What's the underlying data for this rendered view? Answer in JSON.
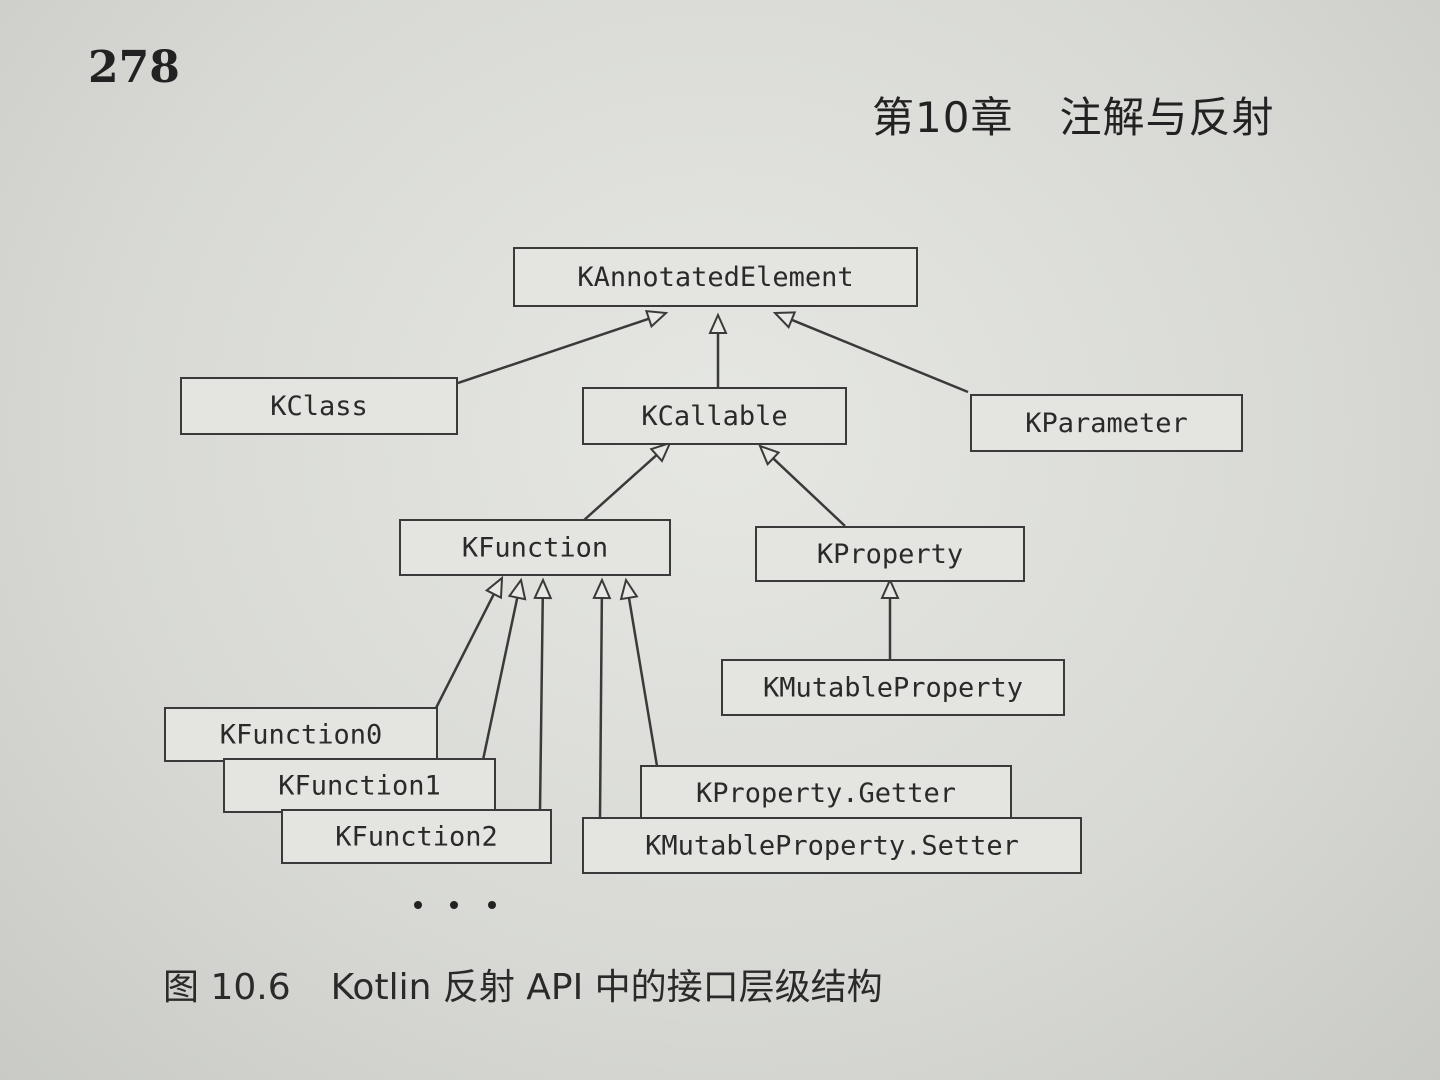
{
  "page_number": "278",
  "header": {
    "chapter": "第10章",
    "title": "注解与反射"
  },
  "diagram": {
    "nodes": {
      "kannotated": "KAnnotatedElement",
      "kclass": "KClass",
      "kcallable": "KCallable",
      "kparameter": "KParameter",
      "kfunction": "KFunction",
      "kproperty": "KProperty",
      "kmutableproperty": "KMutableProperty",
      "kfunction0": "KFunction0",
      "kfunction1": "KFunction1",
      "kfunction2": "KFunction2",
      "kproperty_getter": "KProperty.Getter",
      "kmutableproperty_setter": "KMutableProperty.Setter"
    },
    "edges": [
      [
        "kclass",
        "kannotated"
      ],
      [
        "kcallable",
        "kannotated"
      ],
      [
        "kparameter",
        "kannotated"
      ],
      [
        "kfunction",
        "kcallable"
      ],
      [
        "kproperty",
        "kcallable"
      ],
      [
        "kmutableproperty",
        "kproperty"
      ],
      [
        "kfunction0",
        "kfunction"
      ],
      [
        "kfunction1",
        "kfunction"
      ],
      [
        "kfunction2",
        "kfunction"
      ],
      [
        "kmutableproperty_setter",
        "kfunction"
      ],
      [
        "kproperty_getter",
        "kfunction"
      ]
    ],
    "continuation": "• • •"
  },
  "caption": {
    "figure": "图 10.6",
    "text": "Kotlin 反射 API 中的接口层级结构"
  }
}
